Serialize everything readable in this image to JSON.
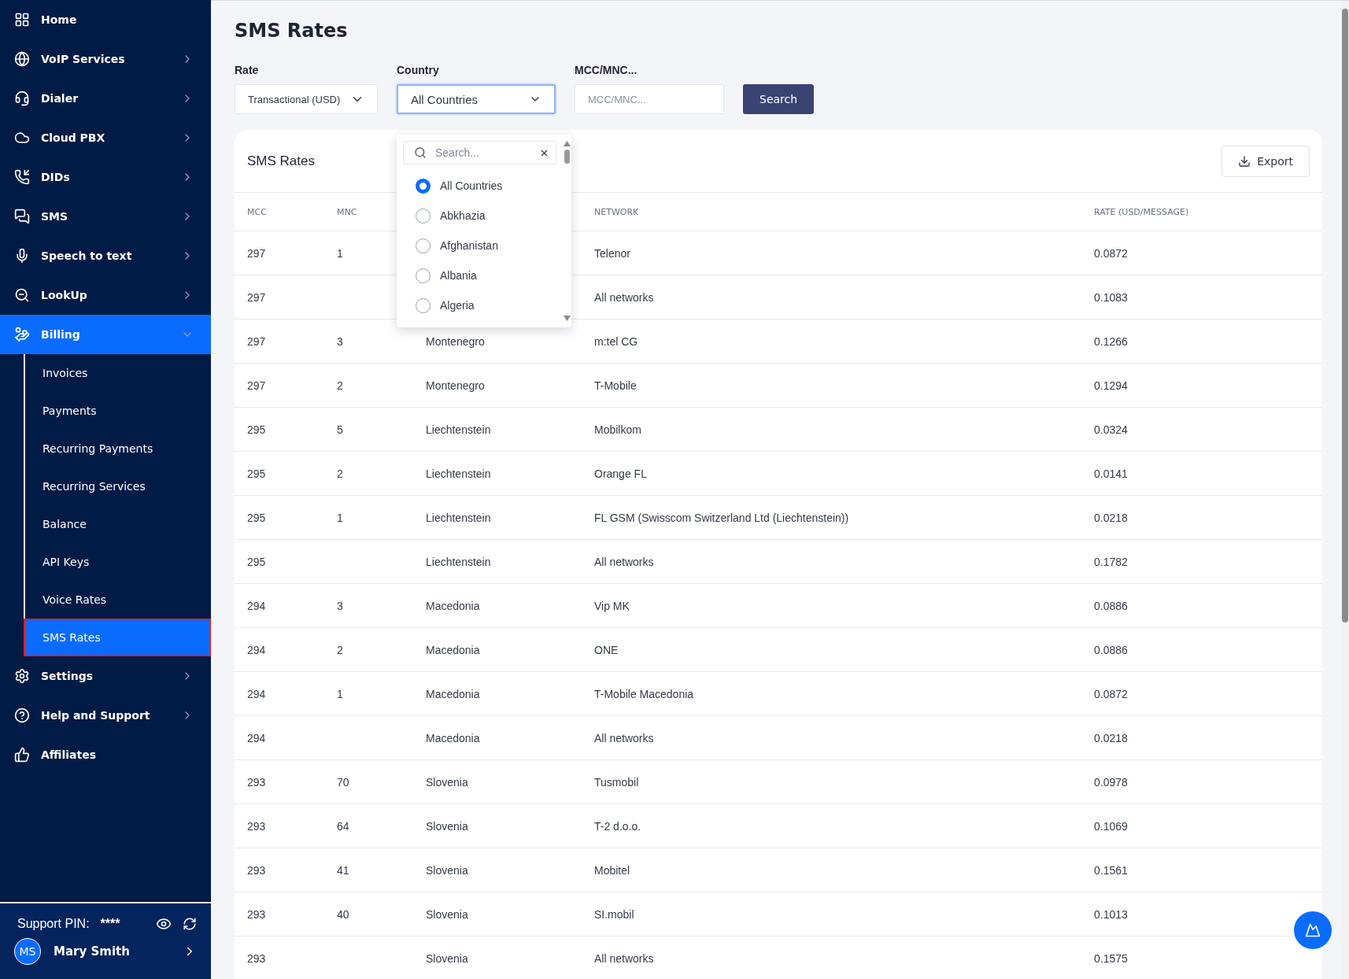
{
  "sidebar": {
    "items": [
      {
        "label": "Home",
        "selected": false
      },
      {
        "label": "VoIP Services",
        "selected": false,
        "expanded": false
      },
      {
        "label": "Dialer",
        "selected": false,
        "expanded": false
      },
      {
        "label": "Cloud PBX",
        "selected": false,
        "expanded": false
      },
      {
        "label": "DIDs",
        "selected": false,
        "expanded": false
      },
      {
        "label": "SMS",
        "selected": false,
        "expanded": false
      },
      {
        "label": "Speech to text",
        "selected": false,
        "expanded": false
      },
      {
        "label": "LookUp",
        "selected": false,
        "expanded": false
      },
      {
        "label": "Billing",
        "selected": true,
        "expanded": true,
        "children": [
          {
            "label": "Invoices",
            "selected": false
          },
          {
            "label": "Payments",
            "selected": false
          },
          {
            "label": "Recurring Payments",
            "selected": false
          },
          {
            "label": "Recurring Services",
            "selected": false
          },
          {
            "label": "Balance",
            "selected": false
          },
          {
            "label": "API Keys",
            "selected": false
          },
          {
            "label": "Voice Rates",
            "selected": false
          },
          {
            "label": "SMS Rates",
            "selected": true
          }
        ]
      },
      {
        "label": "Settings",
        "selected": false,
        "expanded": false
      },
      {
        "label": "Help and Support",
        "selected": false,
        "expanded": false
      },
      {
        "label": "Affiliates",
        "selected": false
      }
    ],
    "support_pin": {
      "label": "Support PIN:",
      "value": "****"
    },
    "user": {
      "initials": "MS",
      "name": "Mary Smith"
    }
  },
  "page": {
    "title": "SMS Rates"
  },
  "filters": {
    "rate": {
      "label": "Rate",
      "value": "Transactional (USD)"
    },
    "country": {
      "label": "Country",
      "value": "All Countries",
      "open": true,
      "search_placeholder": "Search...",
      "options": [
        {
          "label": "All Countries",
          "selected": true
        },
        {
          "label": "Abkhazia",
          "selected": false
        },
        {
          "label": "Afghanistan",
          "selected": false
        },
        {
          "label": "Albania",
          "selected": false
        },
        {
          "label": "Algeria",
          "selected": false
        }
      ]
    },
    "mcc": {
      "label": "MCC/MNC...",
      "placeholder": "MCC/MNC..."
    },
    "search_button": "Search"
  },
  "table": {
    "title": "SMS Rates",
    "export_button": "Export",
    "columns": [
      {
        "label": "MCC"
      },
      {
        "label": "MNC"
      },
      {},
      {
        "label": "NETWORK"
      },
      {
        "label": "RATE (USD/MESSAGE)"
      }
    ],
    "rows": [
      {
        "mcc": "297",
        "mnc": "1",
        "network": "Telenor",
        "rate": "0.0872"
      },
      {
        "mcc": "297",
        "network": "All networks",
        "rate": "0.1083"
      },
      {
        "mcc": "297",
        "mnc": "3",
        "country": "Montenegro",
        "network": "m:tel CG",
        "rate": "0.1266"
      },
      {
        "mcc": "297",
        "mnc": "2",
        "country": "Montenegro",
        "network": "T-Mobile",
        "rate": "0.1294"
      },
      {
        "mcc": "295",
        "mnc": "5",
        "country": "Liechtenstein",
        "network": "Mobilkom",
        "rate": "0.0324"
      },
      {
        "mcc": "295",
        "mnc": "2",
        "country": "Liechtenstein",
        "network": "Orange FL",
        "rate": "0.0141"
      },
      {
        "mcc": "295",
        "mnc": "1",
        "country": "Liechtenstein",
        "network": "FL GSM (Swisscom Switzerland Ltd (Liechtenstein))",
        "rate": "0.0218"
      },
      {
        "mcc": "295",
        "country": "Liechtenstein",
        "network": "All networks",
        "rate": "0.1782"
      },
      {
        "mcc": "294",
        "mnc": "3",
        "country": "Macedonia",
        "network": "Vip MK",
        "rate": "0.0886"
      },
      {
        "mcc": "294",
        "mnc": "2",
        "country": "Macedonia",
        "network": "ONE",
        "rate": "0.0886"
      },
      {
        "mcc": "294",
        "mnc": "1",
        "country": "Macedonia",
        "network": "T-Mobile Macedonia",
        "rate": "0.0872"
      },
      {
        "mcc": "294",
        "country": "Macedonia",
        "network": "All networks",
        "rate": "0.0218"
      },
      {
        "mcc": "293",
        "mnc": "70",
        "country": "Slovenia",
        "network": "Tusmobil",
        "rate": "0.0978"
      },
      {
        "mcc": "293",
        "mnc": "64",
        "country": "Slovenia",
        "network": "T-2 d.o.o.",
        "rate": "0.1069"
      },
      {
        "mcc": "293",
        "mnc": "41",
        "country": "Slovenia",
        "network": "Mobitel",
        "rate": "0.1561"
      },
      {
        "mcc": "293",
        "mnc": "40",
        "country": "Slovenia",
        "network": "SI.mobil",
        "rate": "0.1013"
      },
      {
        "mcc": "293",
        "country": "Slovenia",
        "network": "All networks",
        "rate": "0.1575"
      }
    ]
  }
}
